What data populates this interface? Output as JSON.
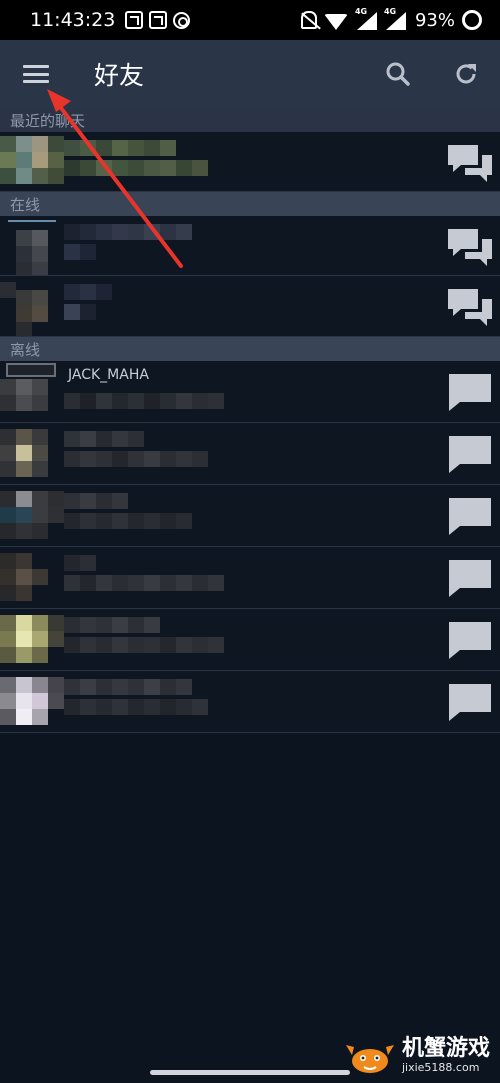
{
  "status_bar": {
    "time": "11:43:23",
    "network_label_1": "4G",
    "network_label_2": "4G",
    "battery": "93%"
  },
  "header": {
    "title": "好友",
    "menu_icon": "hamburger-menu-icon",
    "search_icon": "search-icon",
    "refresh_icon": "refresh-icon"
  },
  "sections": {
    "recent": {
      "label": "最近的聊天"
    },
    "online": {
      "label": "在线"
    },
    "offline": {
      "label": "离线"
    }
  },
  "friends": {
    "offline_first_name": "JACK_MAHA"
  },
  "watermark": {
    "title": "机蟹游戏",
    "url": "jixie5188.com"
  },
  "colors": {
    "header_bg": "#2a3547",
    "content_bg": "#0c1420",
    "section_bg": "#3a4457",
    "chat_icon": "#c6cbd3",
    "annotation_arrow": "#e8342a"
  }
}
